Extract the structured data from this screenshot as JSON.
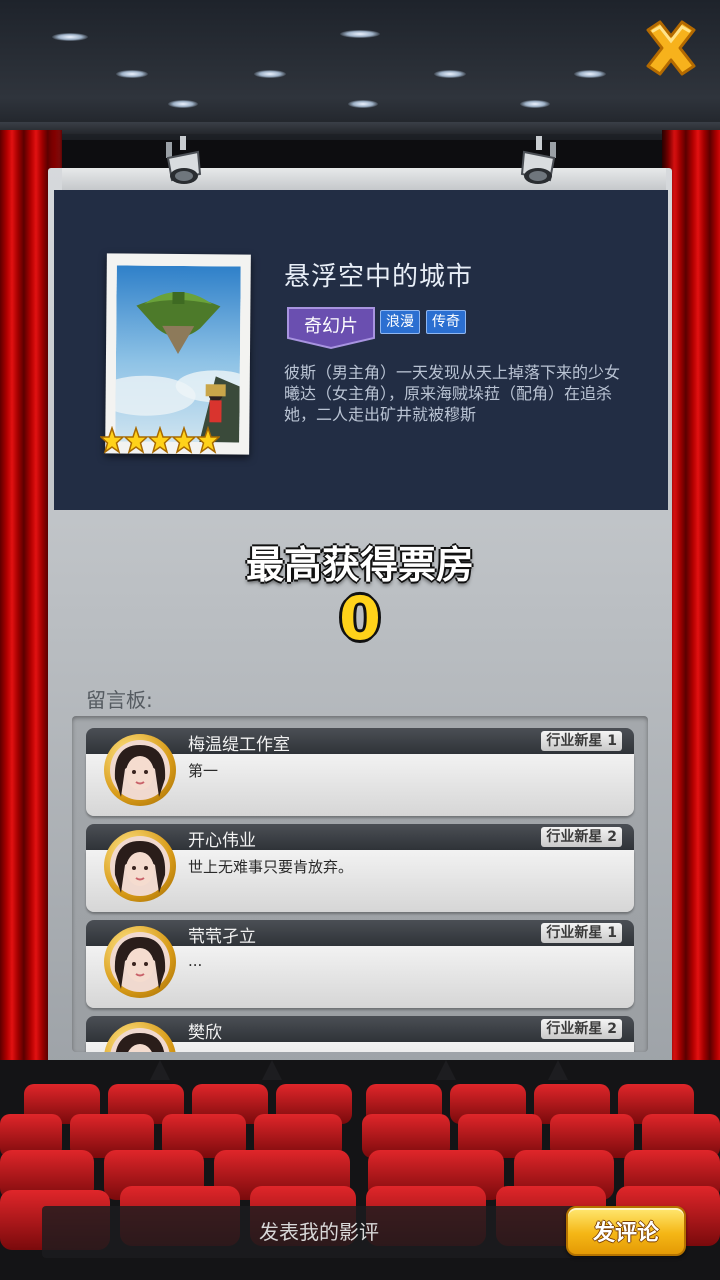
{
  "movie": {
    "title": "悬浮空中的城市",
    "rating_stars": 5,
    "genre_main": "奇幻片",
    "genre_tags": [
      "浪漫",
      "传奇"
    ],
    "synopsis": "彼斯（男主角）一天发现从天上掉落下来的少女曦达（女主角），原来海贼垛菈（配角）在追杀她，二人走出矿井就被穆斯"
  },
  "box_office": {
    "label": "最高获得票房",
    "value": "0"
  },
  "board": {
    "label": "留言板:",
    "comments": [
      {
        "name": "梅温缇工作室",
        "rank": "行业新星 1",
        "text": "第一"
      },
      {
        "name": "开心伟业",
        "rank": "行业新星 2",
        "text": "世上无难事只要肯放弃。"
      },
      {
        "name": "茕茕孑立",
        "rank": "行业新星 1",
        "text": "..."
      },
      {
        "name": "樊欣",
        "rank": "行业新星 2",
        "text": ""
      }
    ]
  },
  "review": {
    "placeholder": "发表我的影评",
    "submit_label": "发评论"
  },
  "icons": {
    "close": "close-icon",
    "star": "star-icon",
    "spotlight": "spotlight-icon",
    "avatar": "avatar"
  },
  "colors": {
    "curtain": "#c40000",
    "panel": "#222d44",
    "gold": "#ffd21a",
    "genre_main": "#6a4fb0",
    "genre_tag": "#2b6fd1"
  }
}
